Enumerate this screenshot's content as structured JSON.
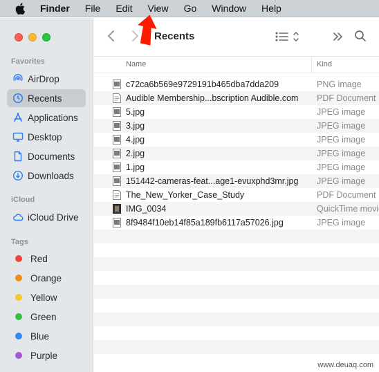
{
  "menubar": {
    "app_name": "Finder",
    "items": [
      "File",
      "Edit",
      "View",
      "Go",
      "Window",
      "Help"
    ]
  },
  "sidebar": {
    "favorites_label": "Favorites",
    "favorites": [
      {
        "label": "AirDrop",
        "icon": "airdrop-icon"
      },
      {
        "label": "Recents",
        "icon": "clock-icon",
        "selected": true
      },
      {
        "label": "Applications",
        "icon": "applications-icon"
      },
      {
        "label": "Desktop",
        "icon": "desktop-icon"
      },
      {
        "label": "Documents",
        "icon": "document-icon"
      },
      {
        "label": "Downloads",
        "icon": "download-icon"
      }
    ],
    "icloud_label": "iCloud",
    "icloud": [
      {
        "label": "iCloud Drive",
        "icon": "cloud-icon"
      }
    ],
    "tags_label": "Tags",
    "tags": [
      {
        "label": "Red",
        "color": "#f2463d"
      },
      {
        "label": "Orange",
        "color": "#f08c1b"
      },
      {
        "label": "Yellow",
        "color": "#f6c62c"
      },
      {
        "label": "Green",
        "color": "#33c048"
      },
      {
        "label": "Blue",
        "color": "#2e8cf4"
      },
      {
        "label": "Purple",
        "color": "#a858d4"
      }
    ]
  },
  "toolbar": {
    "title": "Recents"
  },
  "columns": {
    "name": "Name",
    "kind": "Kind"
  },
  "files": [
    {
      "name": "c72ca6b569e9729191b465dba7dda209",
      "kind": "PNG image",
      "icon": "image-file-icon"
    },
    {
      "name": "Audible Membership...bscription  Audible.com",
      "kind": "PDF Document",
      "icon": "pdf-file-icon"
    },
    {
      "name": "5.jpg",
      "kind": "JPEG image",
      "icon": "image-file-icon"
    },
    {
      "name": "3.jpg",
      "kind": "JPEG image",
      "icon": "image-file-icon"
    },
    {
      "name": "4.jpg",
      "kind": "JPEG image",
      "icon": "image-file-icon"
    },
    {
      "name": "2.jpg",
      "kind": "JPEG image",
      "icon": "image-file-icon"
    },
    {
      "name": "1.jpg",
      "kind": "JPEG image",
      "icon": "image-file-icon"
    },
    {
      "name": "151442-cameras-feat...age1-evuxphd3mr.jpg",
      "kind": "JPEG image",
      "icon": "image-file-icon"
    },
    {
      "name": "The_New_Yorker_Case_Study",
      "kind": "PDF Document",
      "icon": "pdf-file-icon"
    },
    {
      "name": "IMG_0034",
      "kind": "QuickTime movie",
      "icon": "movie-file-icon"
    },
    {
      "name": "8f9484f10eb14f85a189fb6117a57026.jpg",
      "kind": "JPEG image",
      "icon": "image-file-icon"
    }
  ],
  "watermark": "www.deuaq.com"
}
